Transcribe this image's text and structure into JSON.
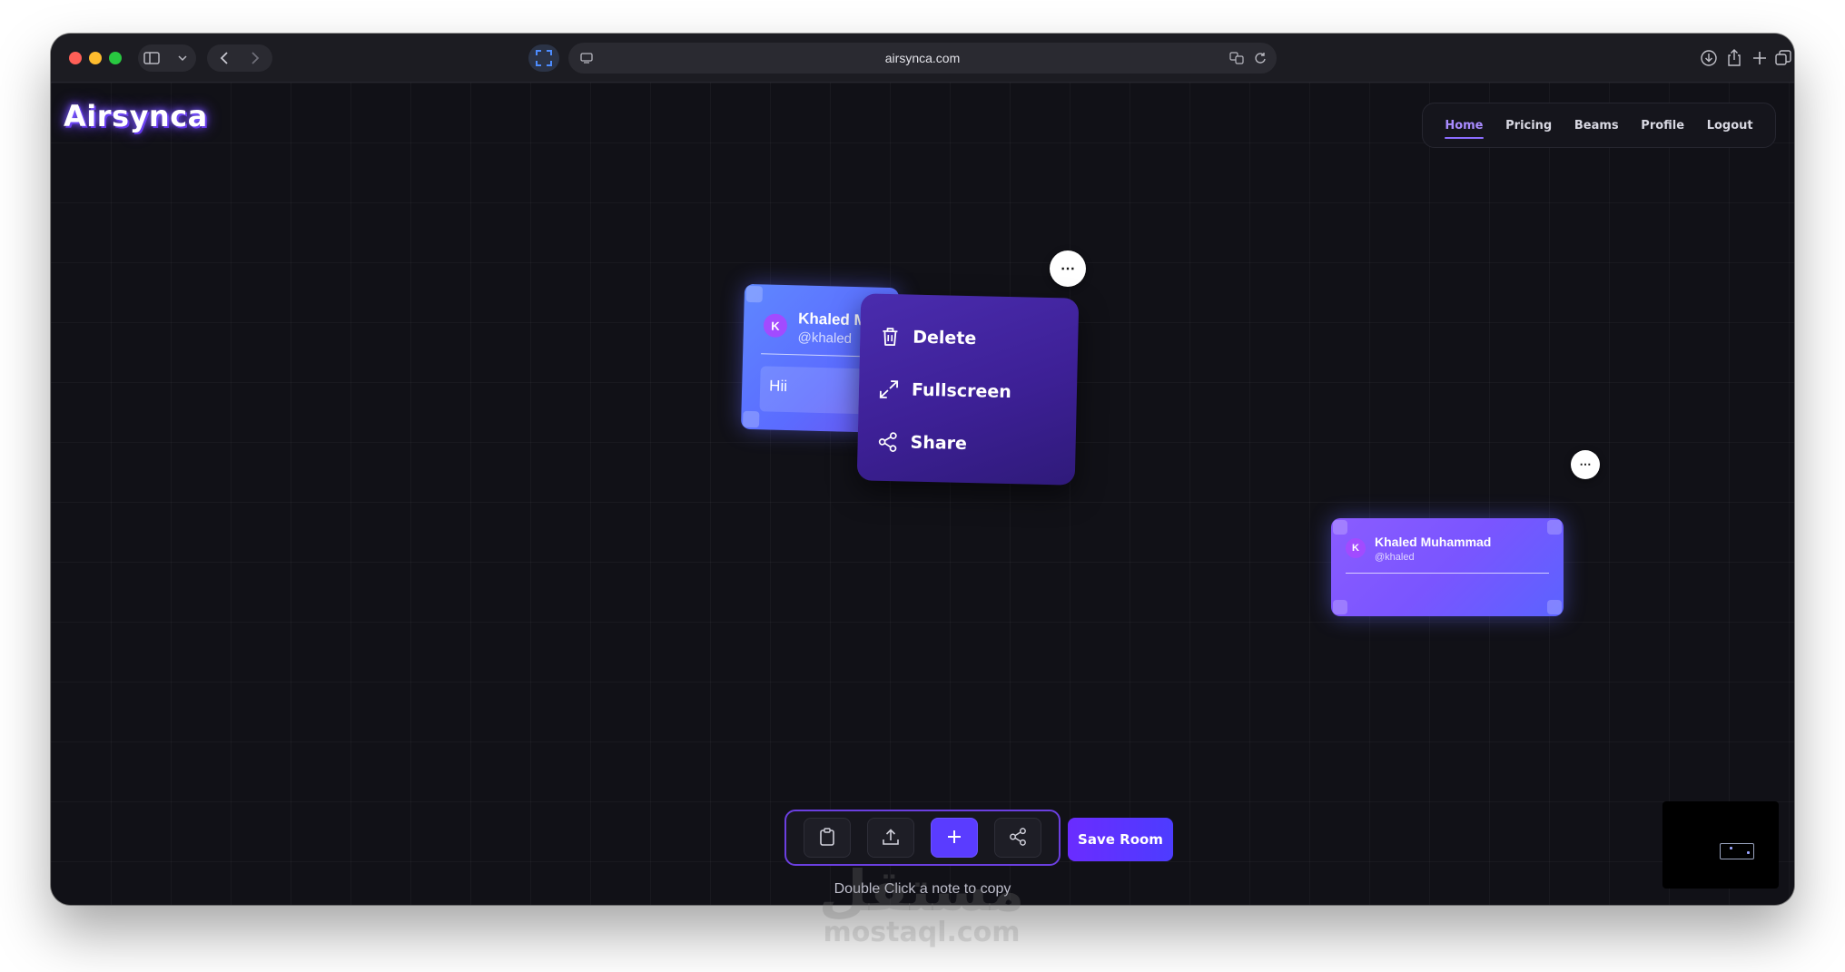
{
  "browser": {
    "url": "airsynca.com",
    "traffic_lights": [
      "#ff5f57",
      "#febc2e",
      "#28c840"
    ]
  },
  "brand": {
    "name": "Airsynca"
  },
  "nav": {
    "items": [
      {
        "label": "Home",
        "active": true
      },
      {
        "label": "Pricing",
        "active": false
      },
      {
        "label": "Beams",
        "active": false
      },
      {
        "label": "Profile",
        "active": false
      },
      {
        "label": "Logout",
        "active": false
      }
    ]
  },
  "notes": [
    {
      "avatar_initial": "K",
      "name": "Khaled M",
      "handle": "@khaled",
      "body": "Hii",
      "more_label": "⋯"
    },
    {
      "avatar_initial": "K",
      "name": "Khaled Muhammad",
      "handle": "@khaled",
      "more_label": "⋯"
    }
  ],
  "context_menu": {
    "items": [
      {
        "label": "Delete",
        "icon": "trash-icon"
      },
      {
        "label": "Fullscreen",
        "icon": "expand-icon"
      },
      {
        "label": "Share",
        "icon": "share-icon"
      }
    ]
  },
  "toolbar": {
    "buttons": [
      "clipboard-icon",
      "upload-icon",
      "plus-icon",
      "share-icon"
    ],
    "save_label": "Save Room",
    "hint": "Double Click a note to copy"
  },
  "watermark": {
    "arabic": "مستقل",
    "latin": "mostaql.com"
  },
  "colors": {
    "accent": "#5a3cff",
    "note_gradient_start": "#5f87ff",
    "menu_bg": "#3d2096",
    "nav_active": "#a98bff"
  }
}
